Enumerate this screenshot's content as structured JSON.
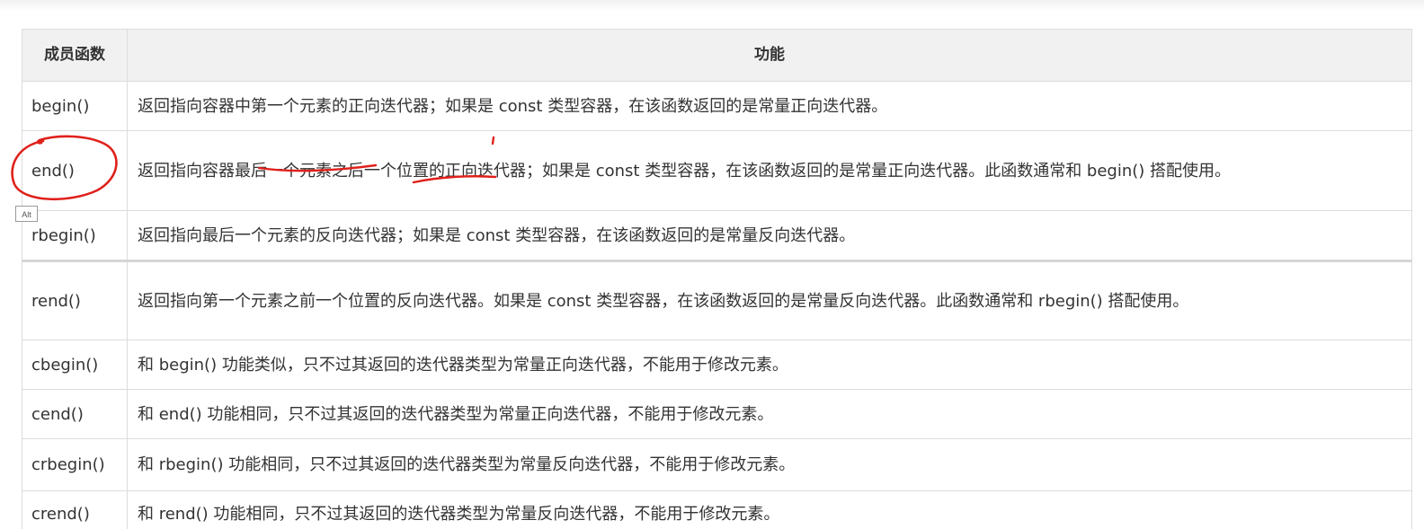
{
  "table": {
    "headers": {
      "member": "成员函数",
      "function": "功能"
    },
    "rows": [
      {
        "member": "begin()",
        "description": "返回指向容器中第一个元素的正向迭代器；如果是 const 类型容器，在该函数返回的是常量正向迭代器。"
      },
      {
        "member": "end()",
        "description": "返回指向容器最后一个元素之后一个位置的正向迭代器；如果是 const 类型容器，在该函数返回的是常量正向迭代器。此函数通常和 begin() 搭配使用。"
      },
      {
        "member": "rbegin()",
        "description": "返回指向最后一个元素的反向迭代器；如果是 const 类型容器，在该函数返回的是常量反向迭代器。"
      },
      {
        "member": "rend()",
        "description": "返回指向第一个元素之前一个位置的反向迭代器。如果是 const 类型容器，在该函数返回的是常量反向迭代器。此函数通常和 rbegin() 搭配使用。"
      },
      {
        "member": "cbegin()",
        "description": "和 begin() 功能类似，只不过其返回的迭代器类型为常量正向迭代器，不能用于修改元素。"
      },
      {
        "member": "cend()",
        "description": "和 end() 功能相同，只不过其返回的迭代器类型为常量正向迭代器，不能用于修改元素。"
      },
      {
        "member": "crbegin()",
        "description": "和 rbegin() 功能相同，只不过其返回的迭代器类型为常量反向迭代器，不能用于修改元素。"
      },
      {
        "member": "crend()",
        "description": "和 rend() 功能相同，只不过其返回的迭代器类型为常量反向迭代器，不能用于修改元素。"
      }
    ]
  },
  "tooltip": {
    "label": "Alt"
  },
  "annotation": {
    "ink_color": "#e0201b"
  }
}
